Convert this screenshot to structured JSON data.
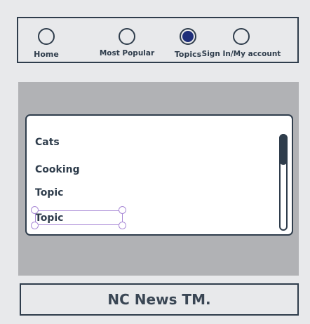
{
  "nav": {
    "items": [
      {
        "label": "Home",
        "active": false
      },
      {
        "label": "Most Popular",
        "active": false
      },
      {
        "label": "Topics",
        "active": true
      },
      {
        "label": "Sign In/My account",
        "active": false
      }
    ]
  },
  "topics": {
    "items": [
      "Cats",
      "Cooking",
      "Topic",
      "Topic"
    ]
  },
  "footer": {
    "text": "NC News TM."
  },
  "colors": {
    "primary": "#2f3d4c",
    "active_radio": "#1f2f7a",
    "selection": "#a98ad6",
    "content_bg": "#b1b2b5",
    "page_bg": "#e8e9eb"
  }
}
